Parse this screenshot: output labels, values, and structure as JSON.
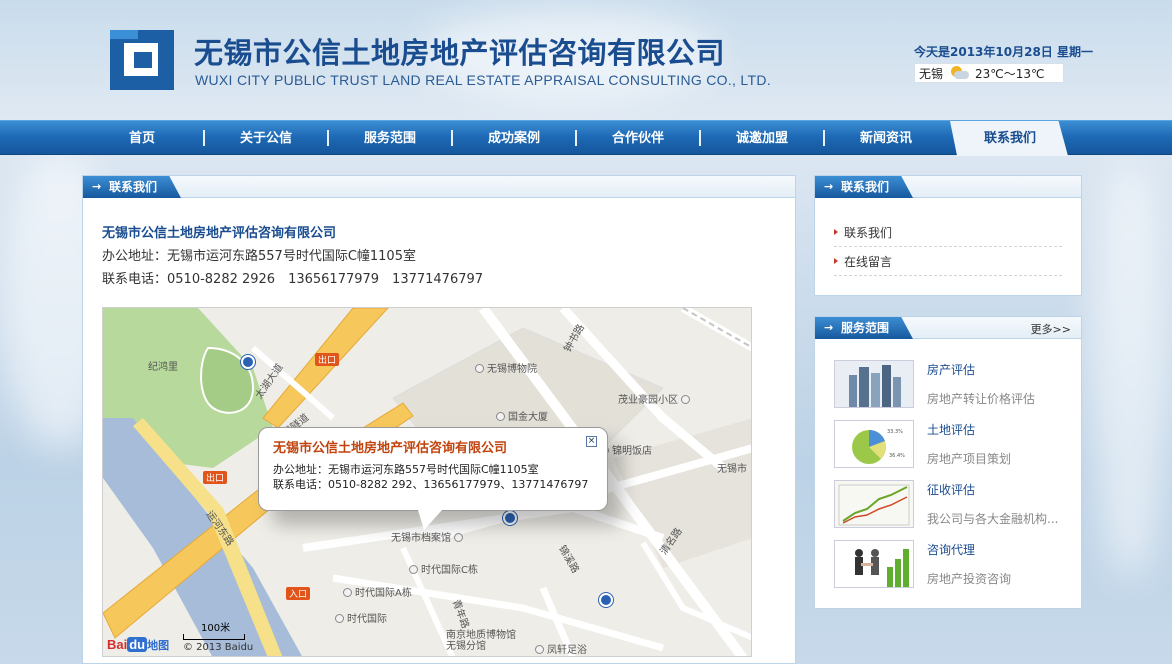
{
  "header": {
    "company_cn": "无锡市公信土地房地产评估咨询有限公司",
    "company_en": "WUXI CITY PUBLIC TRUST LAND REAL ESTATE APPRAISAL CONSULTING CO., LTD.",
    "date": "今天是2013年10月28日 星期一",
    "weather": {
      "city": "无锡",
      "icon": "partly-cloudy-icon",
      "temp": "23℃～13℃"
    }
  },
  "nav": {
    "items": [
      {
        "label": "首页"
      },
      {
        "label": "关于公信"
      },
      {
        "label": "服务范围"
      },
      {
        "label": "成功案例"
      },
      {
        "label": "合作伙伴"
      },
      {
        "label": "诚邀加盟"
      },
      {
        "label": "新闻资讯"
      },
      {
        "label": "联系我们"
      }
    ],
    "active": "联系我们"
  },
  "main": {
    "tab": "联系我们",
    "company_name": "无锡市公信土地房地产评估咨询有限公司",
    "address": "办公地址：无锡市运河东路557号时代国际C幢1105室",
    "phone": "联系电话：0510-8282 2926　13656177979　13771476797"
  },
  "map": {
    "labels": {
      "jihongli": "纪鸿里",
      "museum": "无锡博物院",
      "zhongshu": "钟书路",
      "maoye": "茂业豪园小区",
      "guojin": "国金大厦",
      "jinming": "锦明饭店",
      "wuxi_city": "无锡市",
      "archives": "无锡市档案馆",
      "shidai_c": "时代国际C栋",
      "shidai_a": "时代国际A栋",
      "shidai": "时代国际",
      "nanjing_museum": "南京地质博物馆无锡分馆",
      "fengxuan": "凤轩足浴",
      "qingming": "清名路",
      "jinxi": "锦溪路",
      "qingnian": "青年路",
      "taihu_blvd": "太湖大道",
      "taihu_tunnel": "太湖大道隧道",
      "yunhe_east": "运河东路",
      "exit": "出口",
      "entrance": "入口"
    },
    "popup": {
      "title": "无锡市公信土地房地产评估咨询有限公司",
      "address": "办公地址：无锡市运河东路557号时代国际C幢1105室",
      "phone": "联系电话：0510-8282 292、13656177979、13771476797",
      "close": "×"
    },
    "scale": "100米",
    "baidu_logo": {
      "bai": "Bai",
      "du": "du",
      "tu": "地图"
    },
    "copyright": "© 2013 Baidu"
  },
  "sidebar": {
    "contact": {
      "tab": "联系我们",
      "links": [
        "联系我们",
        "在线留言"
      ]
    },
    "services": {
      "tab": "服务范围",
      "more": "更多>>",
      "items": [
        {
          "title": "房产评估",
          "desc": "房地产转让价格评估",
          "thumb": "buildings-thumb"
        },
        {
          "title": "土地评估",
          "desc": "房地产项目策划",
          "thumb": "pie-chart-thumb"
        },
        {
          "title": "征收评估",
          "desc": "我公司与各大金融机构...",
          "thumb": "line-chart-thumb"
        },
        {
          "title": "咨询代理",
          "desc": "房地产投资咨询",
          "thumb": "handshake-thumb"
        }
      ]
    }
  },
  "colors": {
    "brand": "#1a4d8f",
    "nav": "#1f6bb7",
    "popup_title": "#c1440e"
  }
}
